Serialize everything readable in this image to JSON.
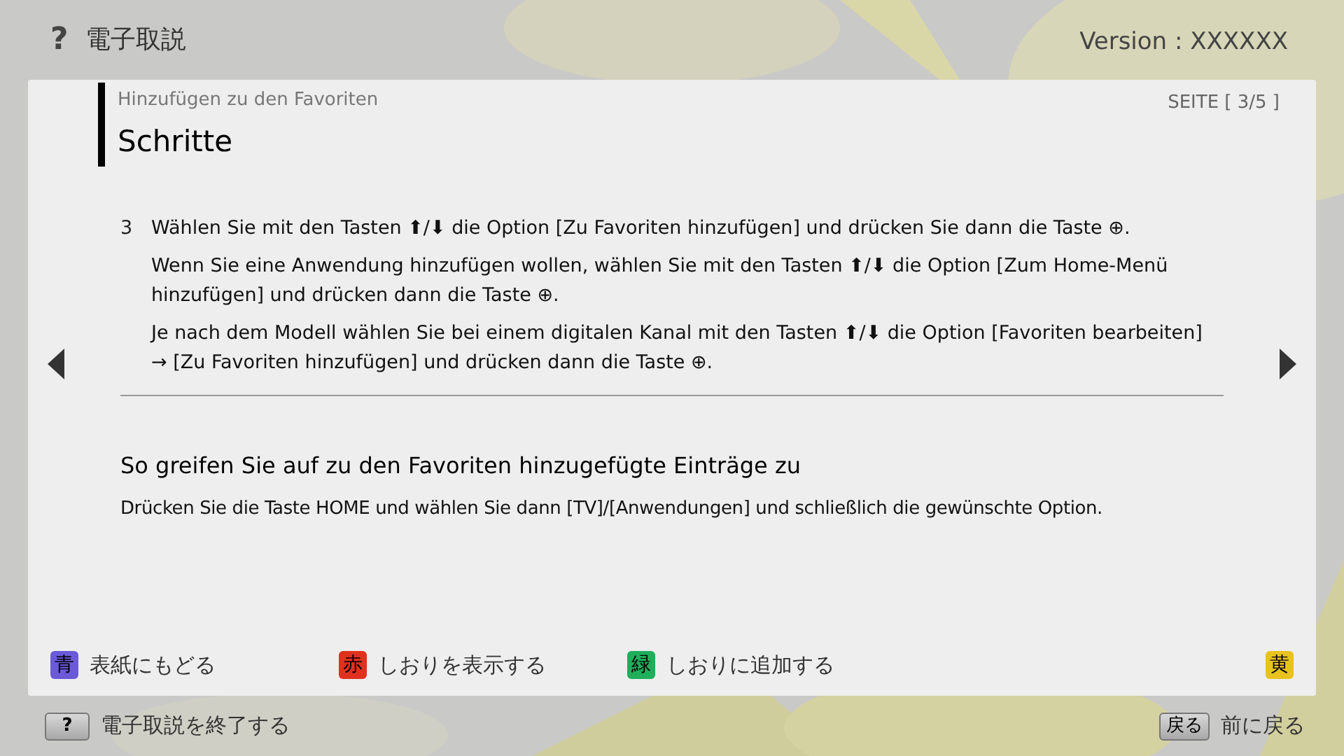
{
  "header": {
    "help_glyph": "?",
    "title": "電子取説",
    "version": "Version : XXXXXX"
  },
  "page": {
    "breadcrumb": "Hinzufügen zu den Favoriten",
    "heading": "Schritte",
    "page_indicator": "SEITE [ 3/5 ]"
  },
  "steps": [
    {
      "number": "3",
      "paragraphs": [
        "Wählen Sie mit den Tasten ⬆/⬇ die Option [Zu Favoriten hinzufügen] und drücken Sie dann die Taste ⊕.",
        "Wenn Sie eine Anwendung hinzufügen wollen, wählen Sie mit den Tasten ⬆/⬇ die Option [Zum Home-Menü hinzufügen] und drücken dann die Taste ⊕.",
        "Je nach dem Modell wählen Sie bei einem digitalen Kanal mit den Tasten ⬆/⬇ die Option [Favoriten bearbeiten] → [Zu Favoriten hinzufügen] und drücken dann die Taste ⊕."
      ]
    }
  ],
  "section": {
    "title": "So greifen Sie auf zu den Favoriten hinzugefügte Einträge zu",
    "body": "Drücken Sie die Taste HOME und wählen Sie dann [TV]/[Anwendungen] und schließlich die gewünschte Option."
  },
  "color_keys": [
    {
      "key": "青",
      "label": "表紙にもどる",
      "color": "#6a5ad8"
    },
    {
      "key": "赤",
      "label": "しおりを表示する",
      "color": "#e0301e"
    },
    {
      "key": "緑",
      "label": "しおりに追加する",
      "color": "#1fae5a"
    },
    {
      "key": "黄",
      "color": "#e8c21e"
    }
  ],
  "footer": {
    "exit_key": "?",
    "exit_label": "電子取説を終了する",
    "back_key": "戻る",
    "back_label": "前に戻る"
  }
}
